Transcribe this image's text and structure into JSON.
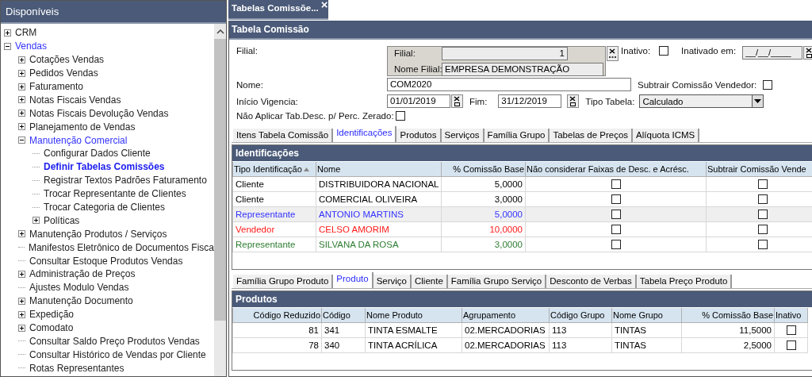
{
  "sidebar": {
    "title": "Disponíveis",
    "items": [
      {
        "label": "CRM",
        "kind": "folder",
        "expanded": false,
        "selected": false
      },
      {
        "label": "Vendas",
        "kind": "folder",
        "expanded": true,
        "selected": false,
        "children": [
          {
            "label": "Cotações Vendas",
            "kind": "folder",
            "expanded": false,
            "selected": false
          },
          {
            "label": "Pedidos Vendas",
            "kind": "folder",
            "expanded": false,
            "selected": false
          },
          {
            "label": "Faturamento",
            "kind": "folder",
            "expanded": false,
            "selected": false
          },
          {
            "label": "Notas Fiscais Vendas",
            "kind": "folder",
            "expanded": false,
            "selected": false
          },
          {
            "label": "Notas Fiscais Devolução Vendas",
            "kind": "folder",
            "expanded": false,
            "selected": false
          },
          {
            "label": "Planejamento de Vendas",
            "kind": "folder",
            "expanded": false,
            "selected": false
          },
          {
            "label": "Manutenção Comercial",
            "kind": "folder",
            "expanded": true,
            "selected": false,
            "children": [
              {
                "label": "Configurar Dados Cliente",
                "kind": "leaf",
                "selected": false
              },
              {
                "label": "Definir Tabelas Comissões",
                "kind": "leaf",
                "selected": true
              },
              {
                "label": "Registrar Textos Padrões Faturamento",
                "kind": "leaf",
                "selected": false
              },
              {
                "label": "Trocar Representante de Clientes",
                "kind": "leaf",
                "selected": false
              },
              {
                "label": "Trocar Categoria de Clientes",
                "kind": "leaf",
                "selected": false
              },
              {
                "label": "Políticas",
                "kind": "folder",
                "expanded": false,
                "selected": false
              }
            ]
          },
          {
            "label": "Manutenção Produtos / Serviços",
            "kind": "folder",
            "expanded": false,
            "selected": false
          },
          {
            "label": "Manifestos Eletrônico de Documentos Fisca",
            "kind": "leaf",
            "selected": false
          },
          {
            "label": "Consultar Estoque Produtos Vendas",
            "kind": "leaf",
            "selected": false
          },
          {
            "label": "Administração de Preços",
            "kind": "folder",
            "expanded": false,
            "selected": false
          },
          {
            "label": "Ajustes Modulo Vendas",
            "kind": "leaf",
            "selected": false
          },
          {
            "label": "Manutenção Documento",
            "kind": "folder",
            "expanded": false,
            "selected": false
          },
          {
            "label": "Expedição",
            "kind": "folder",
            "expanded": false,
            "selected": false
          },
          {
            "label": "Comodato",
            "kind": "folder",
            "expanded": false,
            "selected": false
          },
          {
            "label": "Consultar Saldo Preço Produtos Vendas",
            "kind": "leaf",
            "selected": false
          },
          {
            "label": "Consultar Histórico de Vendas por Cliente",
            "kind": "leaf",
            "selected": false
          },
          {
            "label": "Rotas Representantes",
            "kind": "leaf",
            "selected": false
          }
        ]
      }
    ]
  },
  "document_tab": {
    "label": "Tabelas Comissõe...",
    "close": "×"
  },
  "window": {
    "title": "Tabela Comissão"
  },
  "form": {
    "filial_label": "Filial:",
    "filial_box": {
      "filial_label": "Filial:",
      "filial_value": "1",
      "nome_label": "Nome Filial:",
      "nome_value": "EMPRESA DEMONSTRAÇÃO"
    },
    "inativo": {
      "label": "Inativo:",
      "checked": false
    },
    "inativado_em": {
      "label": "Inativado em:",
      "value": "__/__/____"
    },
    "nome": {
      "label": "Nome:",
      "value": "COM2020"
    },
    "subtrair": {
      "label": "Subtrair Comissão Vendedor:",
      "checked": false
    },
    "inicio": {
      "label": "Início Vigencia:",
      "value": "01/01/2019"
    },
    "fim": {
      "label": "Fim:",
      "value": "31/12/2019"
    },
    "tipo_tabela": {
      "label": "Tipo Tabela:",
      "value": "Calculado"
    },
    "nao_aplicar": {
      "label": "Não  Aplicar Tab.Desc. p/ Perc. Zerado:",
      "checked": false
    }
  },
  "tabs": [
    {
      "label": "Itens Tabela Comissão",
      "selected": false
    },
    {
      "label": "Identificações",
      "selected": true
    },
    {
      "label": "Produtos",
      "selected": false
    },
    {
      "label": "Serviços",
      "selected": false
    },
    {
      "label": "Família Grupo",
      "selected": false
    },
    {
      "label": "Tabelas de Preços",
      "selected": false
    },
    {
      "label": "Alíquota ICMS",
      "selected": false
    }
  ],
  "identificacoes": {
    "title": "Identificações",
    "columns": [
      "Tipo Identificação",
      "Nome",
      "% Comissão Base",
      "Não considerar Faixas de Desc. e Acrésc.",
      "Subtrair Comissão Vende"
    ],
    "rows": [
      {
        "tipo": "Cliente",
        "nome": "DISTRIBUIDORA NACIONAL",
        "percent": "5,0000",
        "nao_considerar": false,
        "subtrair": false,
        "color": "#000000",
        "selected": false
      },
      {
        "tipo": "Cliente",
        "nome": "COMERCIAL OLIVEIRA",
        "percent": "3,0000",
        "nao_considerar": false,
        "subtrair": false,
        "color": "#000000",
        "selected": false
      },
      {
        "tipo": "Representante",
        "nome": "ANTONIO MARTINS",
        "percent": "5,0000",
        "nao_considerar": false,
        "subtrair": false,
        "color": "#3333ff",
        "selected": true
      },
      {
        "tipo": "Vendedor",
        "nome": "CELSO AMORIM",
        "percent": "10,0000",
        "nao_considerar": false,
        "subtrair": false,
        "color": "#ff1a1a",
        "selected": false
      },
      {
        "tipo": "Representante",
        "nome": "SILVANA DA ROSA",
        "percent": "3,0000",
        "nao_considerar": false,
        "subtrair": false,
        "color": "#2e7d32",
        "selected": false
      }
    ]
  },
  "subtabs": [
    {
      "label": "Família Grupo Produto",
      "selected": false
    },
    {
      "label": "Produto",
      "selected": true
    },
    {
      "label": "Serviço",
      "selected": false
    },
    {
      "label": "Cliente",
      "selected": false
    },
    {
      "label": "Família Grupo Serviço",
      "selected": false
    },
    {
      "label": "Desconto de Verbas",
      "selected": false
    },
    {
      "label": "Tabela Preço Produto",
      "selected": false
    }
  ],
  "produtos": {
    "title": "Produtos",
    "columns": [
      "Código Reduzido",
      "Código",
      "Nome Produto",
      "Agrupamento",
      "Código Grupo",
      "Nome Grupo",
      "% Comissão Base",
      "Inativo"
    ],
    "rows": [
      {
        "codigo_reduzido": "81",
        "codigo": "341",
        "nome": "TINTA ESMALTE",
        "agrupamento": "02.MERCADORIAS",
        "codigo_grupo": "113",
        "nome_grupo": "TINTAS",
        "percent": "11,5000",
        "inativo": false
      },
      {
        "codigo_reduzido": "78",
        "codigo": "340",
        "nome": "TINTA ACRÍLICA",
        "agrupamento": "02.MERCADORIAS",
        "codigo_grupo": "113",
        "nome_grupo": "TINTAS",
        "percent": "2,5000",
        "inativo": false
      }
    ]
  }
}
